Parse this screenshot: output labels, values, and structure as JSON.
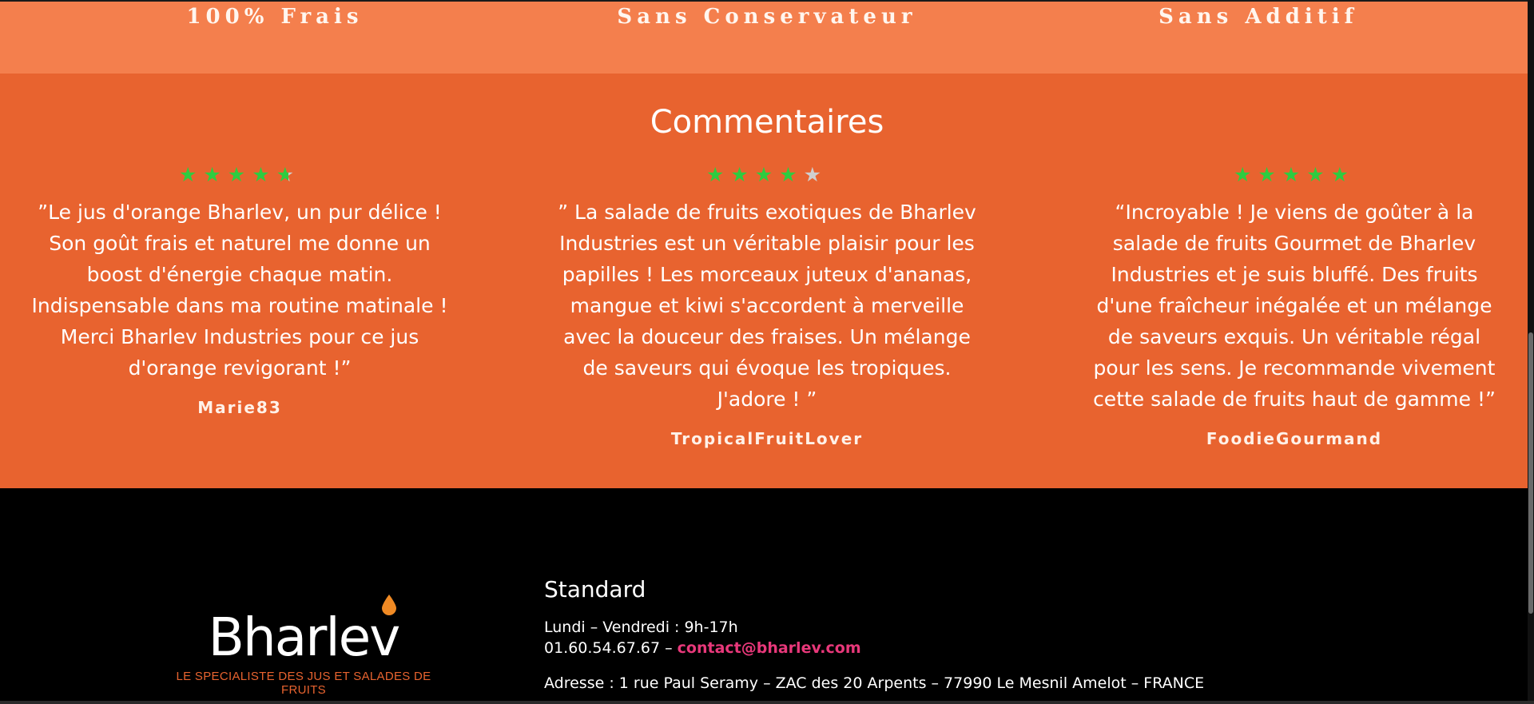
{
  "features": [
    "100% Frais",
    "Sans Conservateur",
    "Sans Additif"
  ],
  "comments": {
    "title": "Commentaires",
    "items": [
      {
        "rating": 4.5,
        "quote": "”Le jus d'orange Bharlev, un pur délice ! Son goût frais et naturel me donne un boost d'énergie chaque matin. Indispensable dans ma routine matinale ! Merci Bharlev Industries pour ce jus d'orange revigorant !”",
        "author": "Marie83"
      },
      {
        "rating": 4,
        "quote": "” La salade de fruits exotiques de Bharlev Industries est un véritable plaisir pour les papilles ! Les morceaux juteux d'ananas, mangue et kiwi s'accordent à merveille avec la douceur des fraises. Un mélange de saveurs qui évoque les tropiques. J'adore ! ”",
        "author": "TropicalFruitLover"
      },
      {
        "rating": 5,
        "quote": "“Incroyable ! Je viens de goûter à la salade de fruits Gourmet de Bharlev Industries et je suis bluffé. Des fruits d'une fraîcheur inégalée et un mélange de saveurs exquis. Un véritable régal pour les sens. Je recommande vivement cette salade de fruits haut de gamme !”",
        "author": "FoodieGourmand"
      }
    ]
  },
  "footer": {
    "logo": {
      "word": "Bharlev",
      "tagline": "LE SPECIALISTE DES JUS ET SALADES DE FRUITS"
    },
    "standard": {
      "title": "Standard",
      "hours": "Lundi – Vendredi : 9h-17h",
      "phone": "01.60.54.67.67 –",
      "email": "contact@bharlev.com",
      "address": "Adresse : 1 rue Paul Seramy – ZAC des 20 Arpents – 77990 Le Mesnil Amelot – FRANCE"
    }
  },
  "colors": {
    "features_bg": "#f47f4d",
    "comments_bg": "#e8632f",
    "star_filled": "#2ecc40",
    "star_empty": "#cfcfcf",
    "email": "#e8387a"
  }
}
